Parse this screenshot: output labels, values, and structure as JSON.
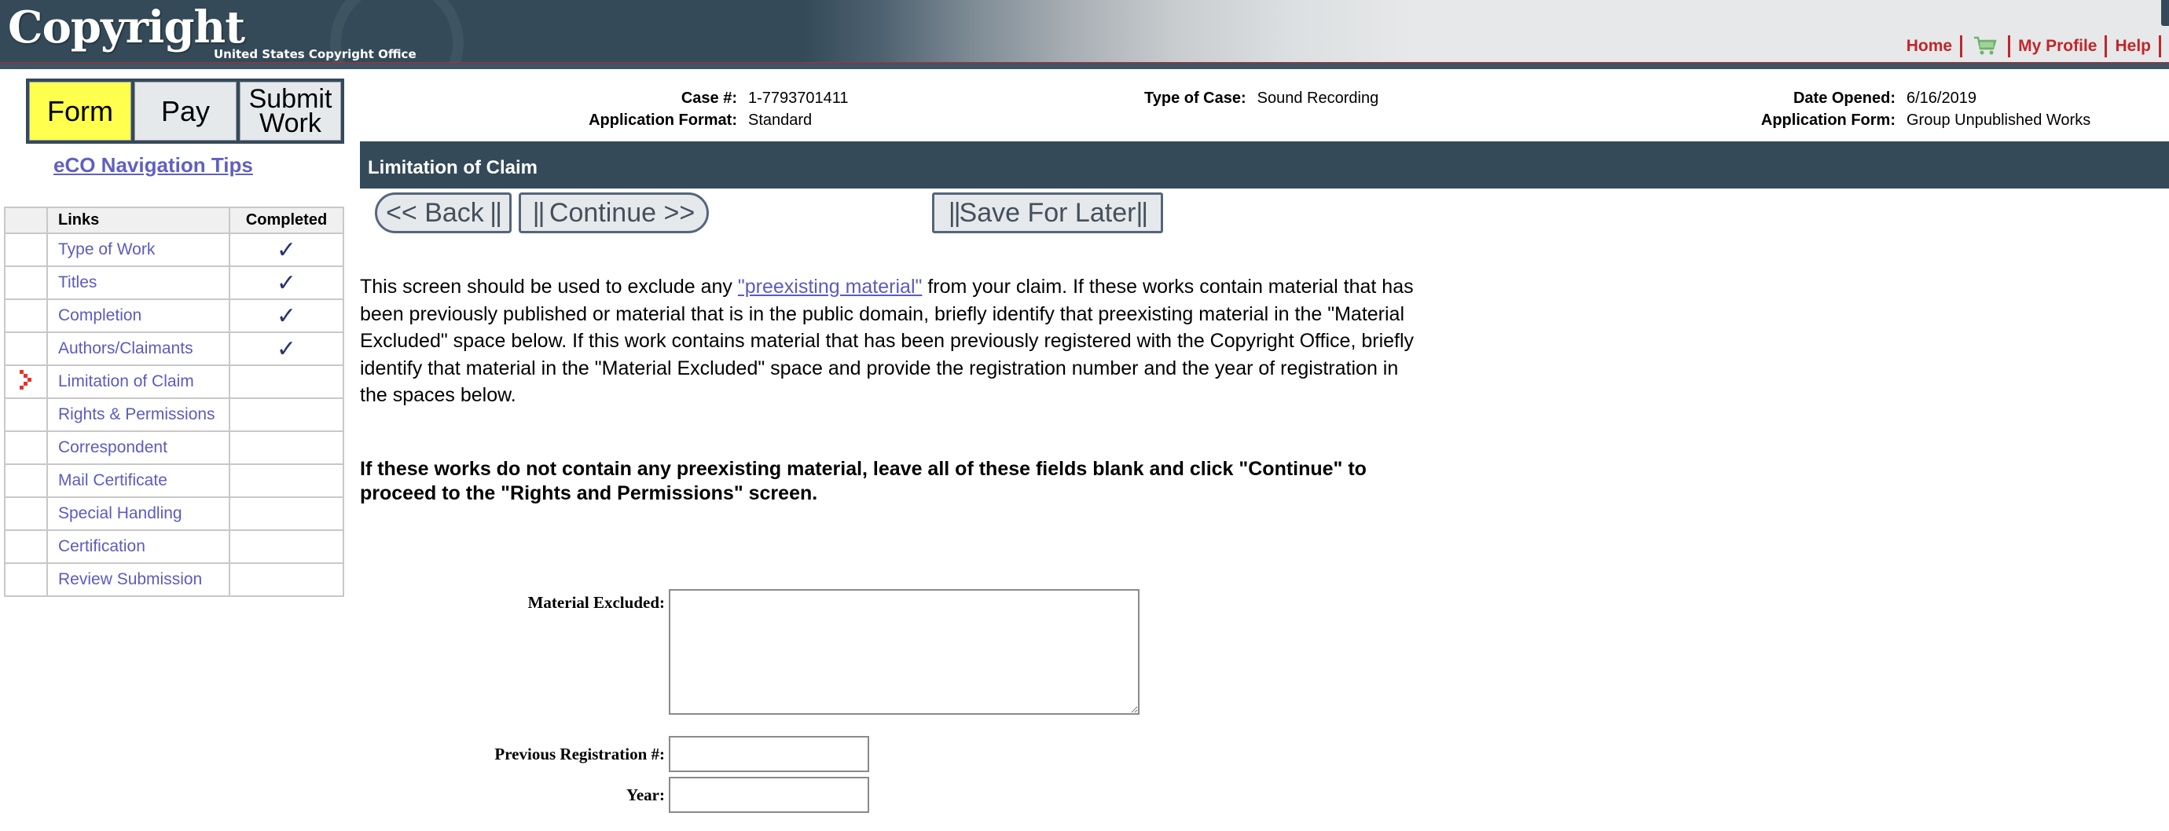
{
  "header": {
    "logo_text": "Copyright",
    "logo_subtext": "United States Copyright Office",
    "links": [
      {
        "label": "Home",
        "icon": null
      },
      {
        "label": "",
        "icon": "shopping-cart-icon"
      },
      {
        "label": "My Profile",
        "icon": null
      },
      {
        "label": "Help",
        "icon": null
      }
    ]
  },
  "phase_nav": {
    "items": [
      {
        "label": "Form",
        "active": true
      },
      {
        "label": "Pay",
        "active": false
      },
      {
        "label_line1": "Submit",
        "label_line2": "Work",
        "active": false
      }
    ]
  },
  "nav_tips_link": "eCO Navigation Tips",
  "links_table": {
    "headers": [
      "",
      "Links",
      "Completed"
    ],
    "rows": [
      {
        "label": "Type of Work",
        "completed": true,
        "current": false
      },
      {
        "label": "Titles",
        "completed": true,
        "current": false
      },
      {
        "label": "Completion",
        "completed": true,
        "current": false
      },
      {
        "label": "Authors/Claimants",
        "completed": true,
        "current": false
      },
      {
        "label": "Limitation of Claim",
        "completed": false,
        "current": true
      },
      {
        "label": "Rights & Permissions",
        "completed": false,
        "current": false
      },
      {
        "label": "Correspondent",
        "completed": false,
        "current": false
      },
      {
        "label": "Mail Certificate",
        "completed": false,
        "current": false
      },
      {
        "label": "Special Handling",
        "completed": false,
        "current": false
      },
      {
        "label": "Certification",
        "completed": false,
        "current": false
      },
      {
        "label": "Review Submission",
        "completed": false,
        "current": false
      }
    ],
    "check_glyph": "✓"
  },
  "case_info": {
    "case_number_label": "Case #:",
    "case_number": "1-7793701411",
    "application_format_label": "Application Format:",
    "application_format": "Standard",
    "type_of_case_label": "Type of Case:",
    "type_of_case": "Sound Recording",
    "date_opened_label": "Date Opened:",
    "date_opened": "6/16/2019",
    "application_form_label": "Application Form:",
    "application_form": "Group Unpublished Works"
  },
  "page_title": "Limitation of Claim",
  "buttons": {
    "back": "<< Back",
    "continue": "Continue >>",
    "save_for_later": "Save For Later"
  },
  "intro": {
    "before_link": "This screen should be used to exclude any ",
    "link_text": "\"preexisting material\"",
    "after_link": " from your claim. If these works contain material that has been previously published or material that is in the public domain, briefly identify that preexisting material in the \"Material Excluded\" space below. If this work contains material that has been previously registered with the Copyright Office, briefly identify that material in the \"Material Excluded\" space and provide the registration number and the year of registration in the spaces below."
  },
  "notice": "If these works do not contain any preexisting material, leave all of these fields blank and click \"Continue\" to proceed to the \"Rights and Permissions\" screen.",
  "form": {
    "material_excluded_label": "Material Excluded:",
    "material_excluded_value": "",
    "previous_registration_label": "Previous Registration #:",
    "previous_registration_value": "",
    "year_label": "Year:",
    "year_value": ""
  },
  "colors": {
    "header_dark": "#344a58",
    "accent_red": "#c0262a",
    "active_phase": "#ffff4d",
    "link_blue": "#5b5bbf"
  }
}
